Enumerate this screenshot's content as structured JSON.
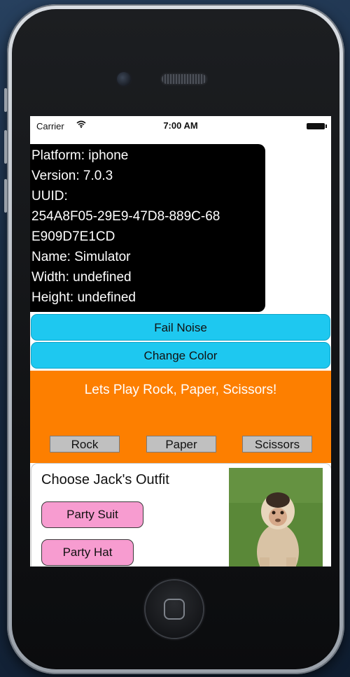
{
  "status_bar": {
    "carrier": "Carrier",
    "wifi_icon": "wifi-icon",
    "time": "7:00 AM",
    "battery_icon": "battery-icon"
  },
  "device_info": {
    "lines": [
      "Platform: iphone",
      "Version: 7.0.3",
      "UUID:",
      "254A8F05-29E9-47D8-889C-68",
      "E909D7E1CD",
      "Name: Simulator",
      "Width: undefined",
      "Height: undefined"
    ]
  },
  "buttons": {
    "fail_noise": "Fail Noise",
    "change_color": "Change Color"
  },
  "rps": {
    "title": "Lets Play Rock, Paper, Scissors!",
    "rock": "Rock",
    "paper": "Paper",
    "scissors": "Scissors"
  },
  "outfit": {
    "title": "Choose Jack's Outfit",
    "party_suit": "Party Suit",
    "party_hat": "Party Hat",
    "photo_icon": "monkey-photo"
  },
  "colors": {
    "info_panel": "#000000",
    "blue_button": "#1ec8f0",
    "orange_panel": "#fd7f00",
    "gray_button": "#c0c0c0",
    "pink_button": "#f79cd0"
  }
}
